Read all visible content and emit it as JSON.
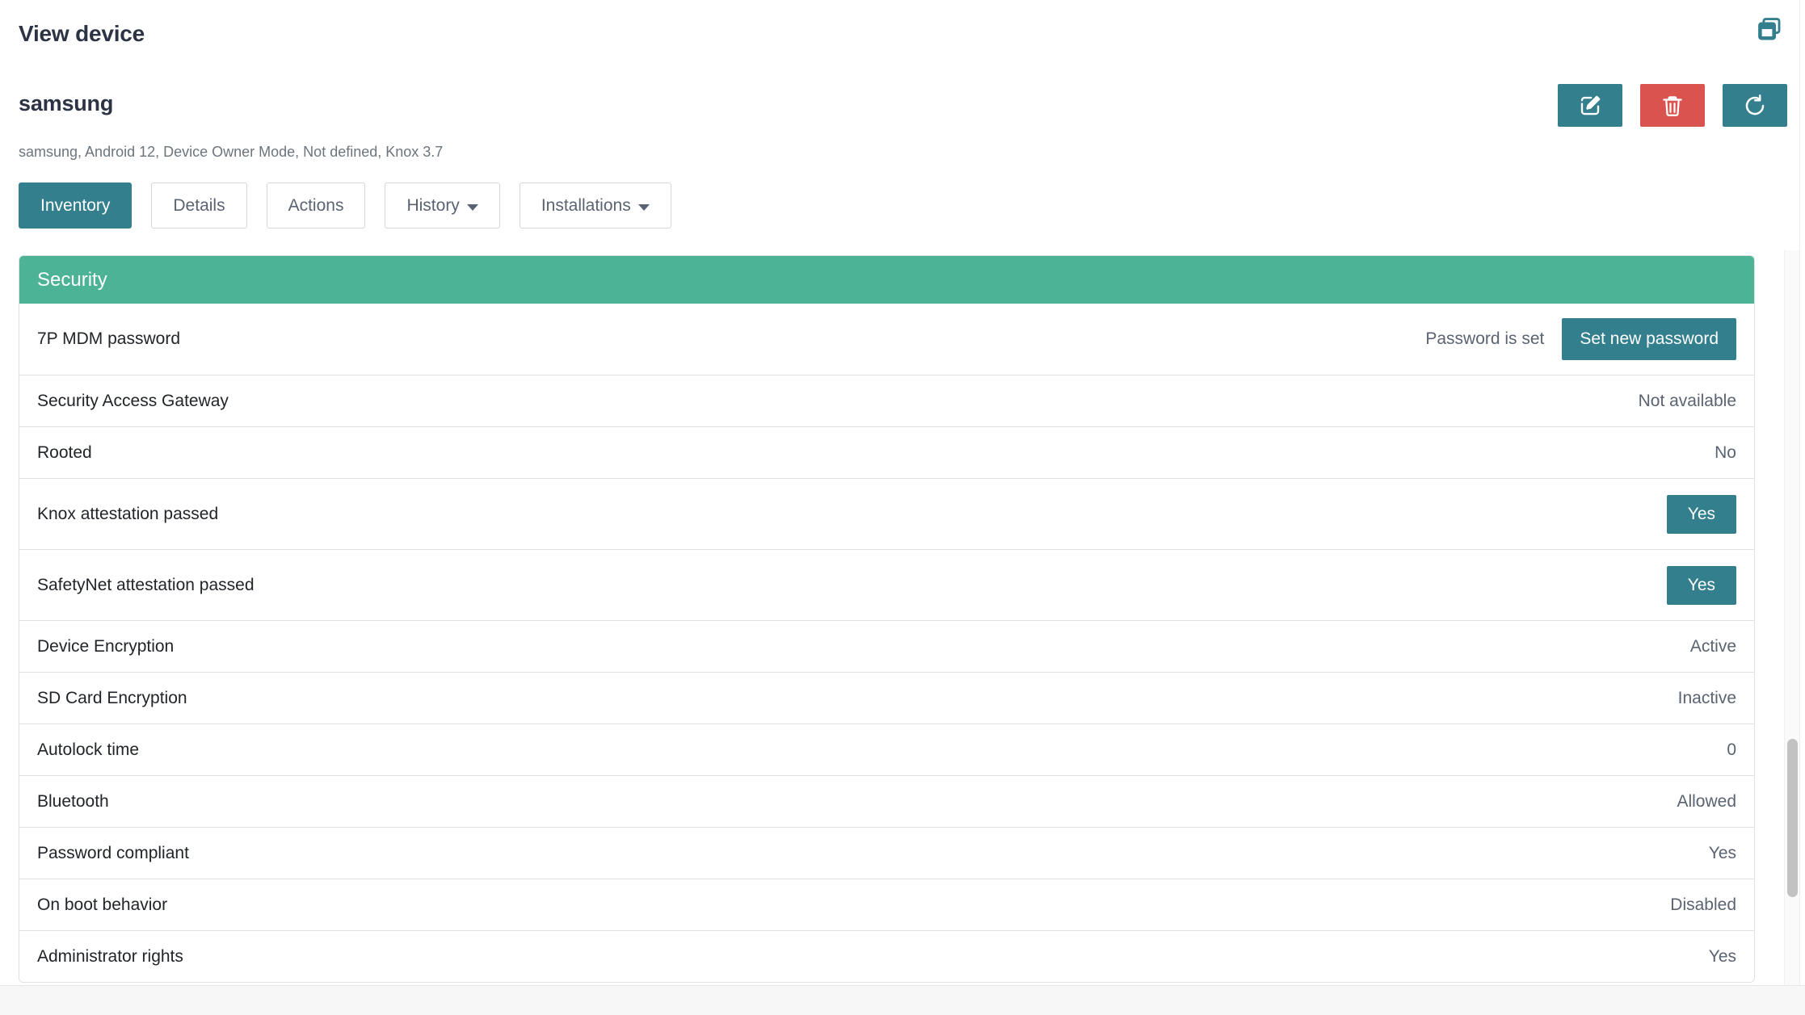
{
  "header": {
    "title": "View device",
    "window_icon": "restore-window-icon"
  },
  "device": {
    "name": "samsung",
    "subtitle": "samsung, Android 12, Device Owner Mode, Not defined, Knox 3.7"
  },
  "actions": [
    {
      "name": "edit-device-button",
      "icon": "edit-pencil-icon",
      "color": "#337f8e"
    },
    {
      "name": "delete-device-button",
      "icon": "trash-icon",
      "color": "#d9534f"
    },
    {
      "name": "refresh-device-button",
      "icon": "refresh-icon",
      "color": "#337f8e"
    }
  ],
  "tabs": [
    {
      "label": "Inventory",
      "active": true,
      "dropdown": false
    },
    {
      "label": "Details",
      "active": false,
      "dropdown": false
    },
    {
      "label": "Actions",
      "active": false,
      "dropdown": false
    },
    {
      "label": "History",
      "active": false,
      "dropdown": true
    },
    {
      "label": "Installations",
      "active": false,
      "dropdown": true
    }
  ],
  "panel": {
    "title": "Security",
    "header_color": "#4cb396",
    "accent_color": "#337f8e",
    "danger_color": "#d9534f",
    "rows": [
      {
        "label": "7P MDM password",
        "value": "Password is set",
        "button": "Set new password",
        "tall": true
      },
      {
        "label": "Security Access Gateway",
        "value": "Not available",
        "button": null
      },
      {
        "label": "Rooted",
        "value": "No",
        "button": null
      },
      {
        "label": "Knox attestation passed",
        "value": "",
        "button": "Yes",
        "badge": true,
        "tall": true
      },
      {
        "label": "SafetyNet attestation passed",
        "value": "",
        "button": "Yes",
        "badge": true,
        "tall": true
      },
      {
        "label": "Device Encryption",
        "value": "Active",
        "button": null
      },
      {
        "label": "SD Card Encryption",
        "value": "Inactive",
        "button": null
      },
      {
        "label": "Autolock time",
        "value": "0",
        "button": null
      },
      {
        "label": "Bluetooth",
        "value": "Allowed",
        "button": null
      },
      {
        "label": "Password compliant",
        "value": "Yes",
        "button": null
      },
      {
        "label": "On boot behavior",
        "value": "Disabled",
        "button": null
      },
      {
        "label": "Administrator rights",
        "value": "Yes",
        "button": null
      }
    ]
  },
  "scrollbar": {
    "name": "vertical-scrollbar"
  }
}
